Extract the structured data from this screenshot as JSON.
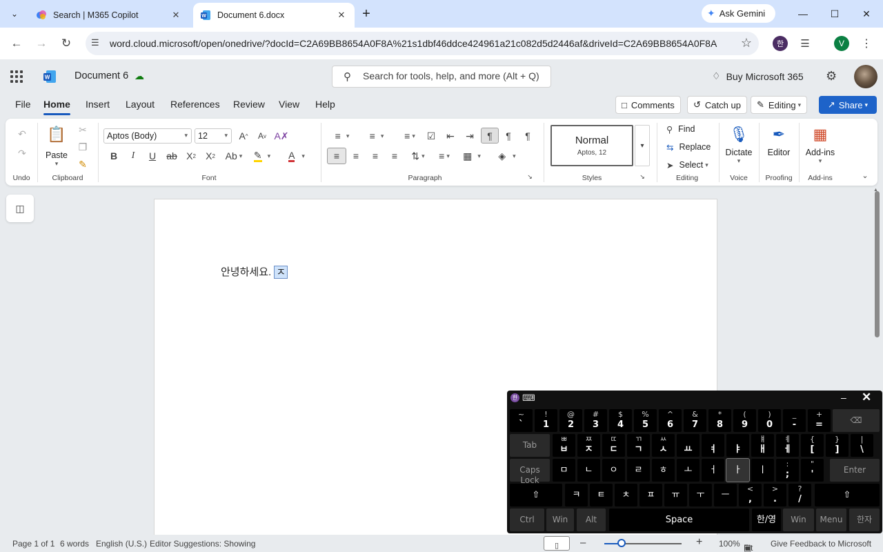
{
  "browser": {
    "tabs": [
      {
        "title": "Search | M365 Copilot"
      },
      {
        "title": "Document 6.docx"
      }
    ],
    "gemini_label": "Ask Gemini",
    "url": "word.cloud.microsoft/open/onedrive/?docId=C2A69BB8654A0F8A%21s1dbf46ddce424961a21c082d5d2446af&driveId=C2A69BB8654A0F8A",
    "profile_initial": "V",
    "ext_initial": "한"
  },
  "app": {
    "doc_title": "Document 6",
    "search_placeholder": "Search for tools, help, and more (Alt + Q)",
    "buy_label": "Buy Microsoft 365"
  },
  "ribbon_tabs": [
    "File",
    "Home",
    "Insert",
    "Layout",
    "References",
    "Review",
    "View",
    "Help"
  ],
  "header_buttons": {
    "comments": "Comments",
    "catchup": "Catch up",
    "editing": "Editing",
    "share": "Share"
  },
  "ribbon": {
    "undo_label": "Undo",
    "clipboard_label": "Clipboard",
    "paste_label": "Paste",
    "font_name": "Aptos (Body)",
    "font_size": "12",
    "font_label": "Font",
    "paragraph_label": "Paragraph",
    "style_name": "Normal",
    "style_sub": "Aptos, 12",
    "styles_label": "Styles",
    "find": "Find",
    "replace": "Replace",
    "select": "Select",
    "editing_label": "Editing",
    "dictate": "Dictate",
    "voice_label": "Voice",
    "editor": "Editor",
    "proofing_label": "Proofing",
    "addins": "Add-ins",
    "addins_label": "Add-ins"
  },
  "document": {
    "text": "안녕하세요.",
    "composing": "ㅈ"
  },
  "status": {
    "page": "Page 1 of 1",
    "words": "6 words",
    "language": "English (U.S.)",
    "editor": "Editor Suggestions: Showing",
    "zoom": "100%",
    "fit": "Fit",
    "feedback": "Give Feedback to Microsoft"
  },
  "keyboard": {
    "row1": [
      [
        "~",
        "`"
      ],
      [
        "!",
        "1"
      ],
      [
        "@",
        "2"
      ],
      [
        "#",
        "3"
      ],
      [
        "$",
        "4"
      ],
      [
        "%",
        "5"
      ],
      [
        "^",
        "6"
      ],
      [
        "&",
        "7"
      ],
      [
        "*",
        "8"
      ],
      [
        "(",
        "9"
      ],
      [
        ")",
        "0"
      ],
      [
        "_",
        "-"
      ],
      [
        "+",
        "="
      ]
    ],
    "row2": [
      [
        "ㅃ",
        "ㅂ"
      ],
      [
        "ㅉ",
        "ㅈ"
      ],
      [
        "ㄸ",
        "ㄷ"
      ],
      [
        "ㄲ",
        "ㄱ"
      ],
      [
        "ㅆ",
        "ㅅ"
      ],
      [
        "",
        "ㅛ"
      ],
      [
        "",
        "ㅕ"
      ],
      [
        "",
        "ㅑ"
      ],
      [
        "ㅒ",
        "ㅐ"
      ],
      [
        "ㅖ",
        "ㅔ"
      ],
      [
        "{",
        "["
      ],
      [
        "}",
        "]"
      ],
      [
        "|",
        "\\"
      ]
    ],
    "row3": [
      "ㅁ",
      "ㄴ",
      "ㅇ",
      "ㄹ",
      "ㅎ",
      "ㅗ",
      "ㅓ",
      "ㅏ",
      "ㅣ",
      [
        ":",
        ";"
      ],
      [
        "\"",
        "'"
      ]
    ],
    "row4": [
      "ㅋ",
      "ㅌ",
      "ㅊ",
      "ㅍ",
      "ㅠ",
      "ㅜ",
      "ㅡ",
      [
        "<",
        ","
      ],
      [
        ">",
        "."
      ],
      [
        "?",
        "/"
      ]
    ],
    "tab": "Tab",
    "caps": "Caps Lock",
    "enter": "Enter",
    "backspace": "⌫",
    "shift": "⇧",
    "ctrl": "Ctrl",
    "win": "Win",
    "alt": "Alt",
    "space": "Space",
    "hanyoung": "한/영",
    "menu": "Menu",
    "hanja": "한자"
  }
}
